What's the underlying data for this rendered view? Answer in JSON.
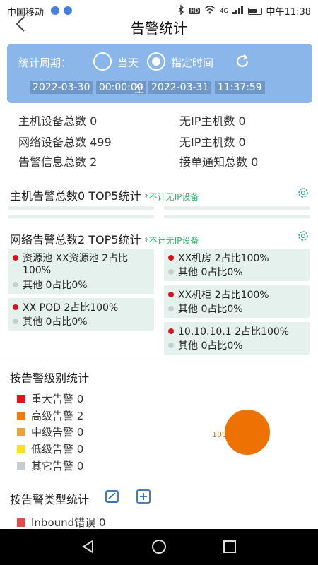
{
  "status_bar": {
    "carrier": "中国移动",
    "network": "4G",
    "hd": "HD",
    "time": "中午11:38"
  },
  "nav": {
    "title": "告警统计",
    "back_icon": "chevron-left-icon"
  },
  "period": {
    "label": "统计周期：",
    "options": [
      "当天",
      "指定时间"
    ],
    "selected": "指定时间",
    "start_date": "2022-03-30",
    "start_time": "00:00:00",
    "separator": "至",
    "end_date": "2022-03-31",
    "end_time": "11:37:59",
    "refresh_icon": "refresh-icon"
  },
  "summary": {
    "host_total": "主机设备总数 0",
    "no_ip_host_1": "无IP主机数 0",
    "network_total": "网络设备总数 499",
    "no_ip_host_2": "无IP主机数 0",
    "alarm_info_total": "告警信息总数 2",
    "ticket_notify_total": "接单通知总数 0"
  },
  "host_section": {
    "title": "主机告警总数0 TOP5统计",
    "note": "*不计无IP设备"
  },
  "network_section": {
    "title": "网络告警总数2 TOP5统计",
    "note": "*不计无IP设备",
    "cards": [
      {
        "main": "资源池 XX资源池 2占比100%",
        "other": "其他 0占比0%"
      },
      {
        "main": "XX POD 2占比100%",
        "other": "其他 0占比0%"
      },
      {
        "main": "XX机房 2占比100%",
        "other": "其他 0占比0%"
      },
      {
        "main": "XX机柜 2占比100%",
        "other": "其他 0占比0%"
      },
      {
        "main": "10.10.10.1 2占比100%",
        "other": "其他 0占比0%"
      }
    ]
  },
  "level_section": {
    "title": "按告警级别统计",
    "items": [
      {
        "label": "重大告警",
        "count": "0",
        "color": "#e2131e"
      },
      {
        "label": "高级告警",
        "count": "2",
        "color": "#ef7b0f"
      },
      {
        "label": "中级告警",
        "count": "0",
        "color": "#e8a33c"
      },
      {
        "label": "低级告警",
        "count": "0",
        "color": "#fbe11a"
      },
      {
        "label": "其它告警",
        "count": "0",
        "color": "#c5cdd0"
      }
    ],
    "pie_label": "100",
    "pie_color": "#ee7203"
  },
  "type_section": {
    "title": "按告警类型统计",
    "edit_icon": "edit-icon",
    "add_icon": "add-square-icon",
    "items": [
      {
        "label": "Inbound错误",
        "count": "0",
        "color": "#e44b4b"
      }
    ]
  }
}
